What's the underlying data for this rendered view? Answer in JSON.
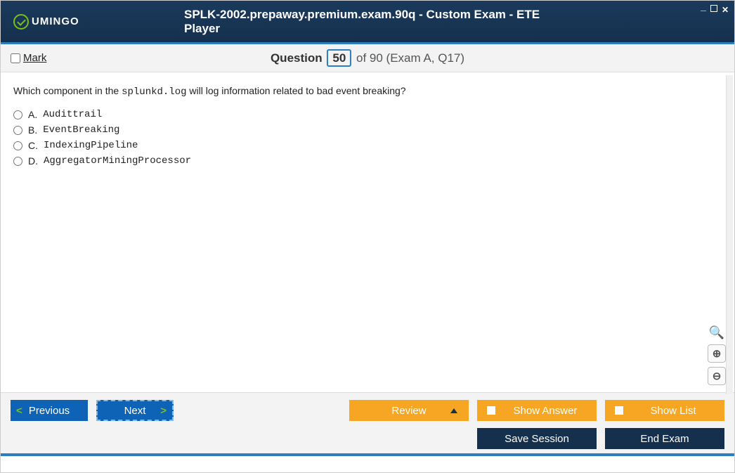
{
  "window": {
    "title": "SPLK-2002.prepaway.premium.exam.90q - Custom Exam - ETE Player"
  },
  "logo": {
    "text": "UMINGO"
  },
  "header": {
    "mark_label": "Mark",
    "question_word": "Question",
    "question_num": "50",
    "of_text": "of 90 (Exam A, Q17)"
  },
  "question": {
    "pre_text": "Which component in the ",
    "code": "splunkd.log",
    "post_text": " will log information related to bad event breaking?"
  },
  "options": [
    {
      "letter": "A.",
      "text": "Audittrail"
    },
    {
      "letter": "B.",
      "text": "EventBreaking"
    },
    {
      "letter": "C.",
      "text": "IndexingPipeline"
    },
    {
      "letter": "D.",
      "text": "AggregatorMiningProcessor"
    }
  ],
  "buttons": {
    "previous": "Previous",
    "next": "Next",
    "review": "Review",
    "show_answer": "Show Answer",
    "show_list": "Show List",
    "save_session": "Save Session",
    "end_exam": "End Exam"
  }
}
